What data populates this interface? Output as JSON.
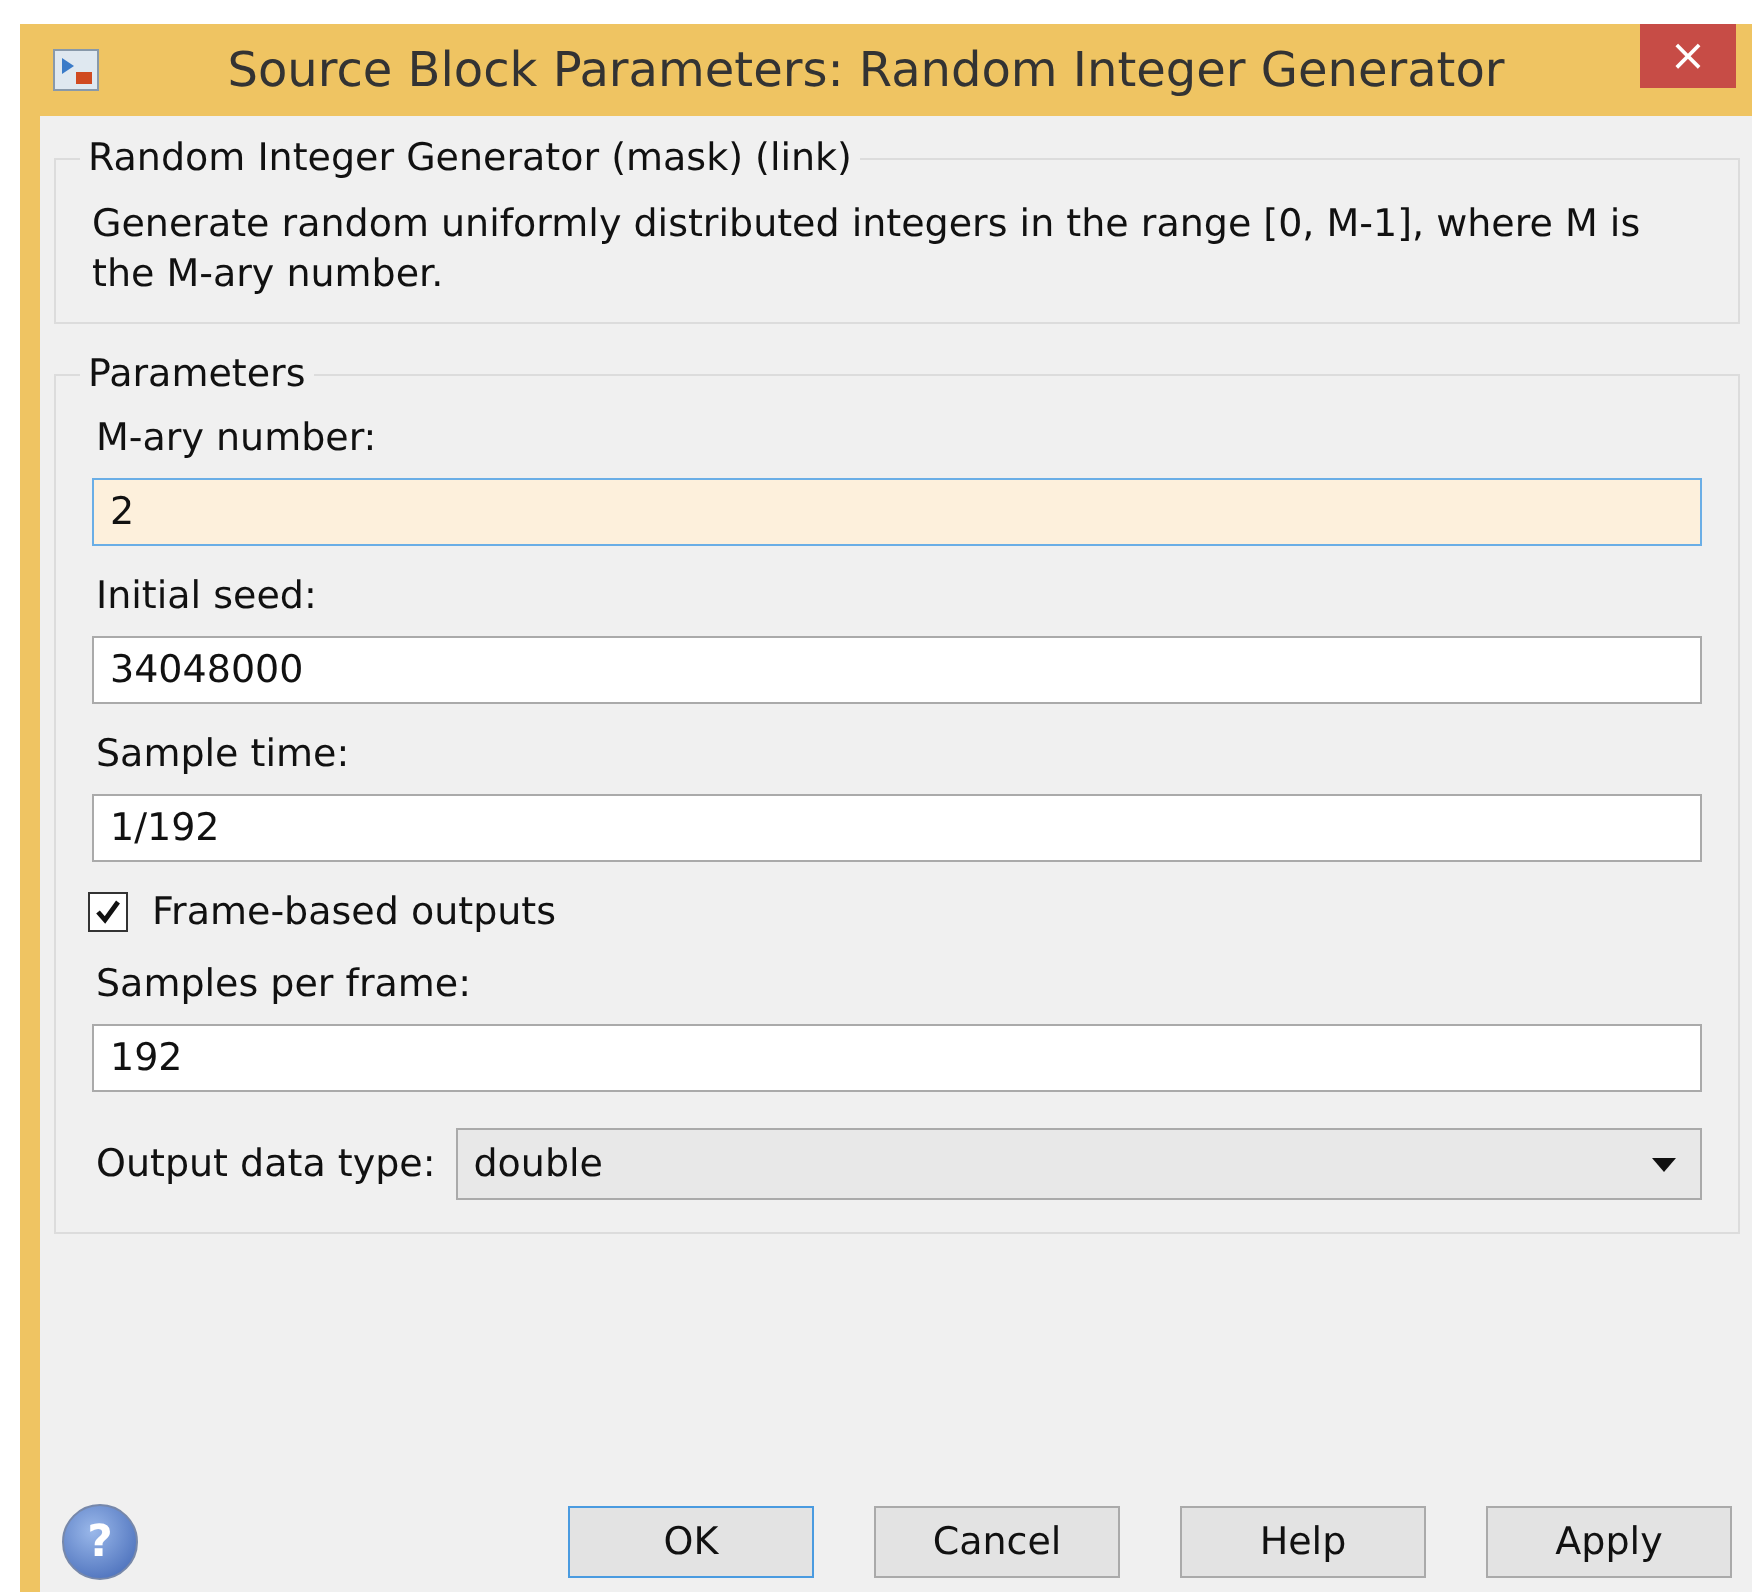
{
  "window": {
    "title": "Source Block Parameters: Random Integer Generator",
    "close": "×"
  },
  "description": {
    "heading": "Random Integer Generator (mask) (link)",
    "text": "Generate random uniformly distributed integers in the range [0, M-1], where M is the M-ary number."
  },
  "parameters": {
    "heading": "Parameters",
    "items": [
      {
        "kind": "field",
        "label": "M-ary number:",
        "value": "2",
        "focused": true
      },
      {
        "kind": "field",
        "label": "Initial seed:",
        "value": "34048000",
        "focused": false
      },
      {
        "kind": "field",
        "label": "Sample time:",
        "value": "1/192",
        "focused": false
      },
      {
        "kind": "checkbox",
        "label": "Frame-based outputs",
        "checked": true
      },
      {
        "kind": "field",
        "label": "Samples per frame:",
        "value": "192",
        "focused": false
      },
      {
        "kind": "dropdown",
        "label": "Output data type:",
        "value": "double"
      }
    ]
  },
  "help": "?",
  "buttons": [
    {
      "label": "OK",
      "default": true
    },
    {
      "label": "Cancel",
      "default": false
    },
    {
      "label": "Help",
      "default": false
    },
    {
      "label": "Apply",
      "default": false
    }
  ]
}
